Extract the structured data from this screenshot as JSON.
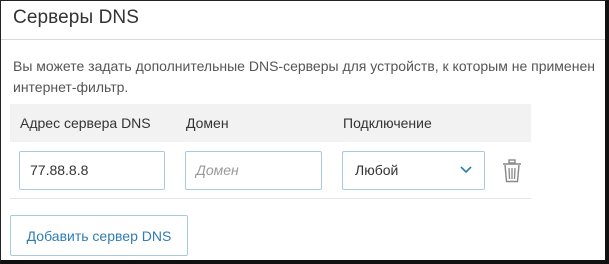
{
  "section": {
    "title": "Серверы DNS",
    "description_line1": "Вы можете задать дополнительные DNS-серверы для устройств, к которым не применен",
    "description_line2": "интернет-фильтр."
  },
  "table": {
    "headers": {
      "address": "Адрес сервера DNS",
      "domain": "Домен",
      "connection": "Подключение"
    },
    "rows": [
      {
        "address": "77.88.8.8",
        "domain_placeholder": "Домен",
        "connection": "Любой",
        "delete_icon": "trash-icon"
      }
    ]
  },
  "add_button_label": "Добавить сервер DNS",
  "colors": {
    "accent": "#2e7db5",
    "input_border": "#a9c9dd",
    "header_bg": "#f2f2f2"
  }
}
